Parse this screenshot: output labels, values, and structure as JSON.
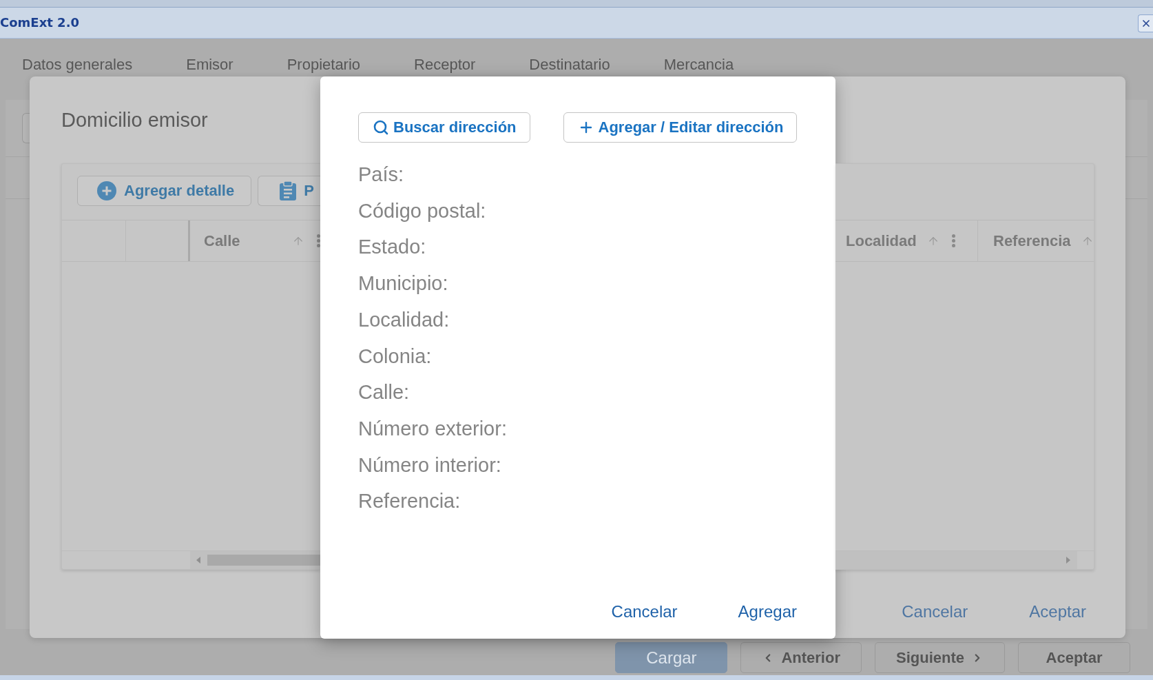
{
  "window": {
    "title": "ComExt 2.0"
  },
  "tabs": [
    {
      "label": "Datos generales",
      "selected": false
    },
    {
      "label": "Emisor",
      "selected": false
    },
    {
      "label": "Propietario",
      "selected": false
    },
    {
      "label": "Receptor",
      "selected": false
    },
    {
      "label": "Destinatario",
      "selected": false
    },
    {
      "label": "Mercancia",
      "selected": false
    }
  ],
  "address_list_dialog": {
    "title": "Domicilio emisor",
    "toolbar": [
      {
        "label": "Agregar detalle",
        "kind": "add"
      },
      {
        "label": "P",
        "kind": "clipboard"
      }
    ],
    "columns_left": [
      {
        "label": "Calle"
      }
    ],
    "columns_right": [
      {
        "label": "Localidad"
      },
      {
        "label": "Referencia"
      }
    ],
    "footer_buttons": [
      {
        "label": "Cancelar"
      },
      {
        "label": "Aceptar"
      }
    ]
  },
  "address_dialog": {
    "buttons": [
      {
        "label": "Buscar dirección",
        "kind": "search"
      },
      {
        "label": "Agregar / Editar dirección",
        "kind": "add"
      }
    ],
    "fields": [
      {
        "label": "País:"
      },
      {
        "label": "Código postal:"
      },
      {
        "label": "Estado:"
      },
      {
        "label": "Municipio:"
      },
      {
        "label": "Localidad:"
      },
      {
        "label": "Colonia:"
      },
      {
        "label": "Calle:"
      },
      {
        "label": "Número exterior:"
      },
      {
        "label": "Número interior:"
      },
      {
        "label": "Referencia:"
      }
    ],
    "footer_buttons": [
      {
        "label": "Cancelar"
      },
      {
        "label": "Agregar"
      }
    ]
  },
  "bottom_bar": {
    "buttons": [
      {
        "label": "Cargar",
        "kind": "primary"
      },
      {
        "label": "Anterior",
        "kind": "previous"
      },
      {
        "label": "Siguiente",
        "kind": "next"
      },
      {
        "label": "Aceptar",
        "kind": "plain"
      }
    ]
  }
}
